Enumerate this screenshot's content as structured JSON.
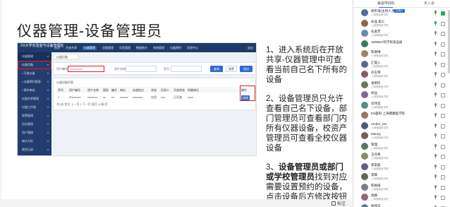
{
  "slide": {
    "title": "仪器管理-设备管理员",
    "screenshot": {
      "logo": "XX大学实验室与设备管理处",
      "menu": [
        "首页",
        "开放共享",
        "仪器管理",
        "设备管理",
        "实验管理",
        "数据统计",
        "系统管理",
        "仪器预约",
        "消息中心"
      ],
      "active_menu": "仪器管理",
      "user": "退出",
      "sidebar": [
        {
          "label": "仪器管理",
          "state": "hl"
        },
        {
          "label": "仪器设备",
          "state": "sel"
        },
        {
          "label": "• 开放仪器",
          "state": ""
        },
        {
          "label": "• 仪器预约管理",
          "state": ""
        },
        {
          "label": "• 预约审核",
          "state": ""
        },
        {
          "label": "仪器共享管理",
          "state": ""
        },
        {
          "label": "仪器工作量",
          "state": ""
        },
        {
          "label": "收费管理",
          "state": ""
        },
        {
          "label": "培训管理",
          "state": ""
        },
        {
          "label": "用户管理",
          "state": ""
        },
        {
          "label": "统计分析",
          "state": ""
        },
        {
          "label": "使用记录",
          "state": ""
        }
      ],
      "crumb": "仪器设备",
      "filter": {
        "label1": "资产编号",
        "value1": "20xxxxxxx",
        "label2": "资产名称",
        "label3": "型号",
        "btn_search": "查询",
        "btn_reset": "重置",
        "btn_export": "导出"
      },
      "table": {
        "caption": "仪器设备列表",
        "headers": [
          "序号",
          "资产编号",
          "资产名称",
          "国别",
          "编号",
          "单价",
          "存放地点",
          "状态",
          "负责人",
          "开放状态",
          "所属单位",
          "操作"
        ],
        "row": [
          "1",
          "20xxxxxx",
          "xxxxxxx",
          "xx",
          "xx",
          "xxxxxx",
          "xxxxxxx",
          "在用",
          "xxx",
          "已开放",
          "xxxx",
          "修改"
        ],
        "pager": "共1条  首页  上一页  1  下一页  尾页  10条/页"
      }
    },
    "notes": [
      {
        "num": "1、",
        "text": "进入系统后在开放共享-仪器管理中可查看当前自己名下所有的设备",
        "bold": ""
      },
      {
        "num": "2、",
        "text": "设备管理员只允许查看自己名下设备，部门管理员可查看部门内所有仪器设备，校资产管理员可查看全校仪器设备",
        "bold": ""
      },
      {
        "num": "3、",
        "bold": "设备管理员或部门或学校管理员",
        "text": "找到对应需要设置预约的设备，点击设备后方修改按钮"
      }
    ],
    "annotate_label": "标注"
  },
  "panel": {
    "tab_active": "会议中(30)",
    "tab_inactive": "未入会",
    "participants": [
      {
        "name": "杨平海(主持人,我)",
        "org": "上海健康医学院",
        "badge": "主持人",
        "mic": "on",
        "cam": "on",
        "color": "#4a6fa5"
      },
      {
        "name": "俞晶 第三",
        "org": "上海健康医学院",
        "mic": "on",
        "cam": "off",
        "color": "#8a6a4a"
      },
      {
        "name": "任爱芳",
        "org": "上海健康医学院",
        "mic": "off",
        "cam": "off",
        "color": "#6a8aa0"
      },
      {
        "name": "1506627的学校高品质",
        "org": "",
        "mic": "off",
        "cam": "off",
        "color": "#3c7a5a"
      },
      {
        "name": "陈琳琳",
        "org": "上海健康医学院",
        "mic": "off",
        "cam": "off",
        "color": "#a0806a"
      },
      {
        "name": "汇能入",
        "org": "上海健康医学院",
        "mic": "off",
        "cam": "off",
        "color": "#5a6a8a"
      },
      {
        "name": "孙玉琴",
        "org": "上海健康医学院",
        "mic": "off",
        "cam": "off",
        "color": "#8a5a6a"
      },
      {
        "name": "张明珍",
        "org": "上海健康医学院",
        "mic": "off",
        "cam": "off",
        "color": "#6a7a5a"
      },
      {
        "name": "徐益",
        "org": "上海健康医学院",
        "mic": "off",
        "cam": "off",
        "color": "#7a6a9a"
      },
      {
        "name": "邓玮莹",
        "org": "上海健康医学院",
        "mic": "off",
        "cam": "off",
        "color": "#5a8a8a"
      },
      {
        "name": "EX晨阳-上海健康医学院",
        "org": "",
        "mic": "off",
        "cam": "off",
        "color": "#9a7a5a"
      },
      {
        "name": "Amber_SG",
        "org": "上海健康医学院",
        "mic": "off",
        "cam": "off",
        "color": "#4a5a7a"
      },
      {
        "name": "Maung",
        "org": "上海健康医学院",
        "mic": "off",
        "cam": "off",
        "color": "#7a5a5a"
      },
      {
        "name": "管理",
        "org": "上海健康医学院",
        "mic": "off",
        "cam": "off",
        "color": "#5a7a6a"
      },
      {
        "name": "王丹青",
        "org": "上海健康医学院",
        "mic": "off",
        "cam": "off",
        "color": "#8a8a6a"
      },
      {
        "name": "郭安瓿",
        "org": "上海健康医学院",
        "mic": "off",
        "cam": "off",
        "color": "#6a5a8a"
      },
      {
        "name": "李霖",
        "org": "上海健康医学院",
        "mic": "off",
        "cam": "off",
        "color": "#5a6a5a"
      },
      {
        "name": "陈瓶纸",
        "org": "上海健康医学院",
        "mic": "off",
        "cam": "off",
        "color": "#7a7a8a"
      },
      {
        "name": "袁静",
        "org": "上海健康医学院",
        "mic": "off",
        "cam": "off",
        "color": "#8a6a7a"
      },
      {
        "name": "施伟志",
        "org": "上海健康医学院",
        "mic": "off",
        "cam": "off",
        "color": "#5a7a8a"
      }
    ]
  }
}
